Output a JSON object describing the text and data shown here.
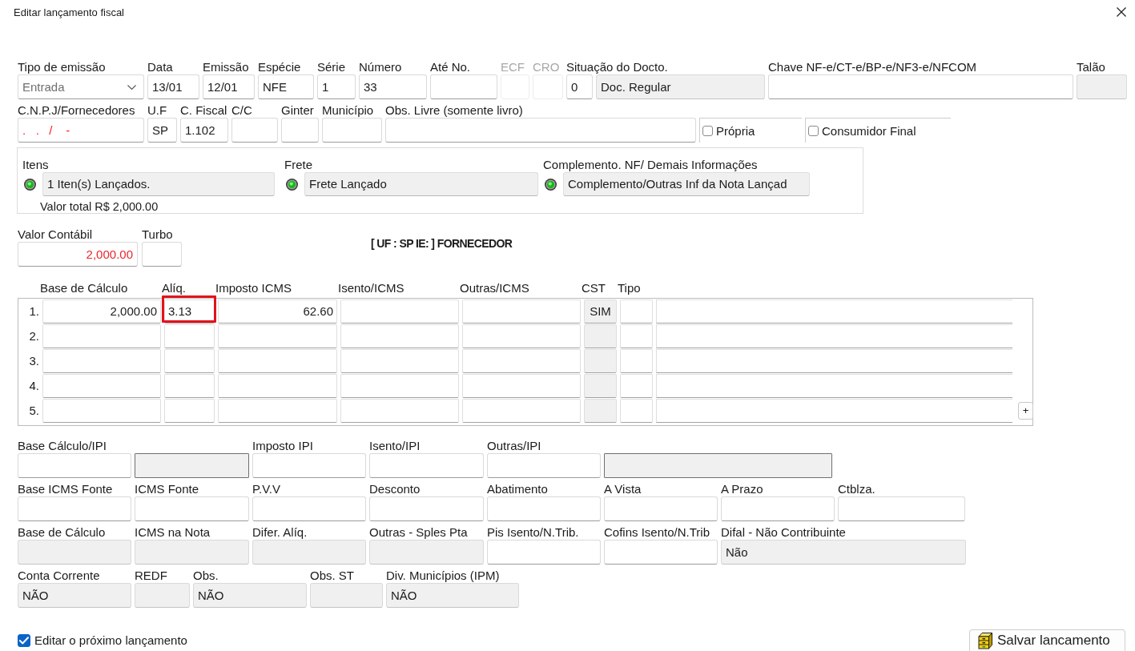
{
  "window": {
    "title": "Editar lançamento fiscal"
  },
  "header_rows": [
    [
      {
        "kind": "select",
        "label": "Tipo de emissão",
        "value": "Entrada",
        "disabled": false
      },
      {
        "kind": "text",
        "label": "Data",
        "value": "13/01",
        "readonly": false,
        "disabled": false
      },
      {
        "kind": "text",
        "label": "Emissão",
        "value": "12/01",
        "readonly": false,
        "disabled": false
      },
      {
        "kind": "text",
        "label": "Espécie",
        "value": "NFE",
        "readonly": false,
        "disabled": false
      },
      {
        "kind": "text",
        "label": "Série",
        "value": "1",
        "readonly": false,
        "disabled": false
      },
      {
        "kind": "text",
        "label": "Número",
        "value": "33",
        "readonly": false,
        "disabled": false
      },
      {
        "kind": "text",
        "label": "Até No.",
        "readonly": false,
        "disabled": false
      },
      {
        "kind": "text",
        "label": "ECF",
        "readonly": false,
        "disabled": true
      },
      {
        "kind": "text",
        "label": "CRO",
        "readonly": false,
        "disabled": true
      },
      {
        "kind": "pair",
        "label": "Situação do Docto.",
        "disabled": false,
        "parts": [
          {
            "value": "0",
            "readonly": false
          },
          {
            "value": "Doc. Regular",
            "readonly": true
          }
        ]
      },
      {
        "kind": "text",
        "label": "Chave NF-e/CT-e/BP-e/NF3-e/NFCOM",
        "readonly": false,
        "disabled": false
      },
      {
        "kind": "text",
        "label": "Talão",
        "readonly": true,
        "disabled": false
      }
    ],
    [
      {
        "kind": "text",
        "label": "C.N.P.J/Fornecedores",
        "value": ".   .   /    -",
        "color": "#ff1a1a",
        "readonly": false,
        "disabled": false
      },
      {
        "kind": "text",
        "label": "U.F",
        "value": "SP",
        "readonly": false,
        "disabled": false
      },
      {
        "kind": "text",
        "label": "C. Fiscal",
        "value": "1.102",
        "readonly": false,
        "disabled": false
      },
      {
        "kind": "text",
        "label": "C/C",
        "readonly": false,
        "disabled": false
      },
      {
        "kind": "text",
        "label": "Ginter",
        "readonly": false,
        "disabled": false
      },
      {
        "kind": "text",
        "label": "Município",
        "readonly": false,
        "disabled": false
      },
      {
        "kind": "text",
        "label": "Obs. Livre (somente livro)",
        "readonly": false,
        "disabled": false
      },
      {
        "kind": "checkbox",
        "label": "Própria",
        "checked": false,
        "disabled": false
      },
      {
        "kind": "checkbox",
        "label": "Consumidor Final",
        "checked": false,
        "disabled": false
      }
    ]
  ],
  "launch_status": [
    {
      "label": "Itens",
      "status": "1 Iten(s) Lançados.",
      "note": "Valor total R$ 2,000.00"
    },
    {
      "label": "Frete",
      "status": "Frete Lançado"
    },
    {
      "label": "Complemento. NF/ Demais Informações",
      "status": "Complemento/Outras Inf da Nota Lançad"
    }
  ],
  "summary": {
    "fields": [
      {
        "label": "Valor Contábil",
        "value": "2,000.00",
        "color": "#e8262d",
        "readonly": false
      },
      {
        "label": "Turbo",
        "readonly": false
      }
    ],
    "supplier_info": "[ UF : SP IE: ] FORNECEDOR"
  },
  "icms_grid": {
    "columns": [
      {
        "label": "Base de Cálculo",
        "readonly": false
      },
      {
        "label": "Alíq.",
        "readonly": false
      },
      {
        "label": "Imposto ICMS",
        "readonly": false
      },
      {
        "label": "Isento/ICMS",
        "readonly": false
      },
      {
        "label": "Outras/ICMS",
        "readonly": false
      },
      {
        "label": "CST",
        "readonly": true
      },
      {
        "label": "Tipo",
        "readonly": false
      },
      {
        "readonly": false
      }
    ],
    "rows": [
      {
        "number": "1.",
        "cells": [
          {
            "value": "2,000.00",
            "highlighted": false
          },
          {
            "value": "3.13",
            "highlighted": true
          },
          {
            "value": "62.60",
            "highlighted": false
          },
          {
            "highlighted": false
          },
          {
            "highlighted": false
          },
          {
            "value": "SIM",
            "highlighted": false
          },
          {
            "highlighted": false
          },
          {
            "highlighted": false
          }
        ]
      },
      {
        "number": "2."
      },
      {
        "number": "3."
      },
      {
        "number": "4."
      },
      {
        "number": "5."
      }
    ],
    "add_button": "+"
  },
  "tax_rows": [
    [
      {
        "kind": "text",
        "label": "Base Cálculo/IPI",
        "readonly": false
      },
      {
        "kind": "frame",
        "readonly": true
      },
      {
        "kind": "text",
        "label": "Imposto IPI",
        "readonly": false
      },
      {
        "kind": "text",
        "label": "Isento/IPI",
        "readonly": false
      },
      {
        "kind": "text",
        "label": "Outras/IPI",
        "readonly": false
      },
      {
        "kind": "frame",
        "readonly": true
      }
    ],
    [
      {
        "kind": "text",
        "label": "Base ICMS Fonte",
        "readonly": false
      },
      {
        "kind": "text",
        "label": "ICMS Fonte",
        "readonly": false
      },
      {
        "kind": "text",
        "label": "P.V.V",
        "readonly": false
      },
      {
        "kind": "text",
        "label": "Desconto",
        "readonly": false
      },
      {
        "kind": "text",
        "label": "Abatimento",
        "readonly": false
      },
      {
        "kind": "text",
        "label": "A Vista",
        "readonly": false
      },
      {
        "kind": "text",
        "label": "A Prazo",
        "readonly": false
      },
      {
        "kind": "text",
        "label": "Ctblza.",
        "readonly": false
      }
    ],
    [
      {
        "kind": "text",
        "label": "Base de Cálculo",
        "readonly": true
      },
      {
        "kind": "text",
        "label": "ICMS na Nota",
        "readonly": true
      },
      {
        "kind": "text",
        "label": "Difer. Alíq.",
        "readonly": true
      },
      {
        "kind": "text",
        "label": "Outras - Sples Pta",
        "readonly": true
      },
      {
        "kind": "text",
        "label": "Pis Isento/N.Trib.",
        "readonly": false
      },
      {
        "kind": "text",
        "label": "Cofins Isento/N.Trib",
        "readonly": false
      },
      {
        "kind": "text",
        "label": "Difal - Não Contribuinte",
        "value": "Não",
        "readonly": true
      }
    ],
    [
      {
        "kind": "text",
        "label": "Conta Corrente",
        "value": "NÃO",
        "readonly": true
      },
      {
        "kind": "text",
        "label": "REDF",
        "readonly": true
      },
      {
        "kind": "text",
        "label": "Obs.",
        "value": "NÃO",
        "readonly": true
      },
      {
        "kind": "text",
        "label": "Obs. ST",
        "readonly": true
      },
      {
        "kind": "text",
        "label": "Div. Municípios (IPM)",
        "value": "NÃO",
        "readonly": true
      }
    ]
  ],
  "footer": {
    "next_entry": {
      "label": "Editar o próximo lançamento",
      "checked": true
    },
    "save_button": "Salvar lancamento"
  }
}
